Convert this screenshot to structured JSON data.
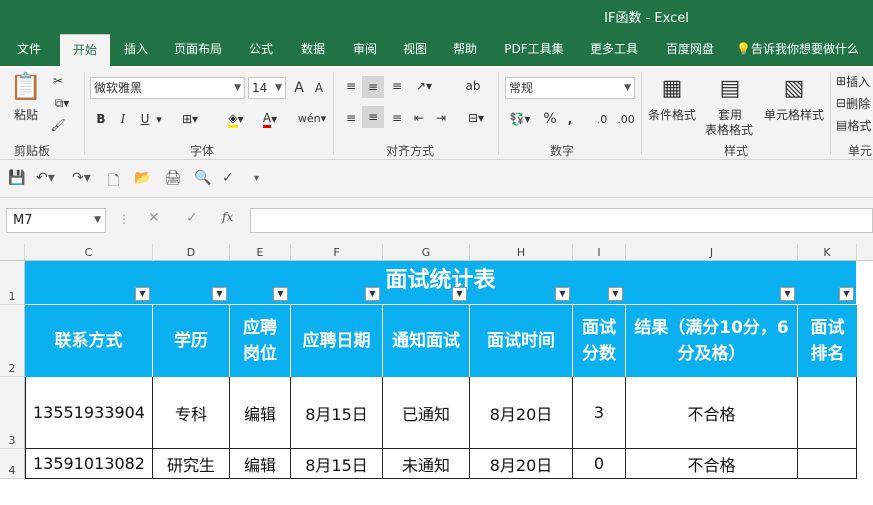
{
  "window": {
    "title": "IF函数 - Excel"
  },
  "tabs": [
    "文件",
    "开始",
    "插入",
    "页面布局",
    "公式",
    "数据",
    "审阅",
    "视图",
    "帮助",
    "PDF工具集",
    "更多工具",
    "百度网盘"
  ],
  "tell_me": "告诉我你想要做什么",
  "ribbon": {
    "clipboard": {
      "paste": "粘贴",
      "label": "剪贴板"
    },
    "font": {
      "name": "微软雅黑",
      "size": "14",
      "label": "字体",
      "bold": "B",
      "italic": "I",
      "underline": "U"
    },
    "alignment": {
      "label": "对齐方式"
    },
    "number": {
      "format": "常规",
      "label": "数字",
      "percent": "%",
      "comma": ","
    },
    "styles": {
      "cond_format": "条件格式",
      "table_format_1": "套用",
      "table_format_2": "表格格式",
      "cell_styles": "单元格样式",
      "label": "样式"
    },
    "cells": {
      "insert": "插入",
      "delete": "删除",
      "format": "格式",
      "label": "单元"
    }
  },
  "namebox": "M7",
  "formula": {
    "fx": "fx",
    "value": ""
  },
  "columns": [
    "C",
    "D",
    "E",
    "F",
    "G",
    "H",
    "I",
    "J",
    "K"
  ],
  "rows": [
    "1",
    "2",
    "3",
    "4"
  ],
  "sheet": {
    "title": "面试统计表",
    "headers": [
      "联系方式",
      "学历",
      "应聘岗位",
      "应聘日期",
      "通知面试",
      "面试时间",
      "面试分数",
      "结果（满分10分，6分及格）",
      "面试排名"
    ],
    "data": [
      [
        "13551933904",
        "专科",
        "编辑",
        "8月15日",
        "已通知",
        "8月20日",
        "3",
        "不合格",
        ""
      ],
      [
        "13591013082",
        "研究生",
        "编辑",
        "8月15日",
        "未通知",
        "8月20日",
        "0",
        "不合格",
        ""
      ]
    ]
  },
  "colors": {
    "excel_green": "#217346",
    "header_blue": "#0bb0f0"
  }
}
